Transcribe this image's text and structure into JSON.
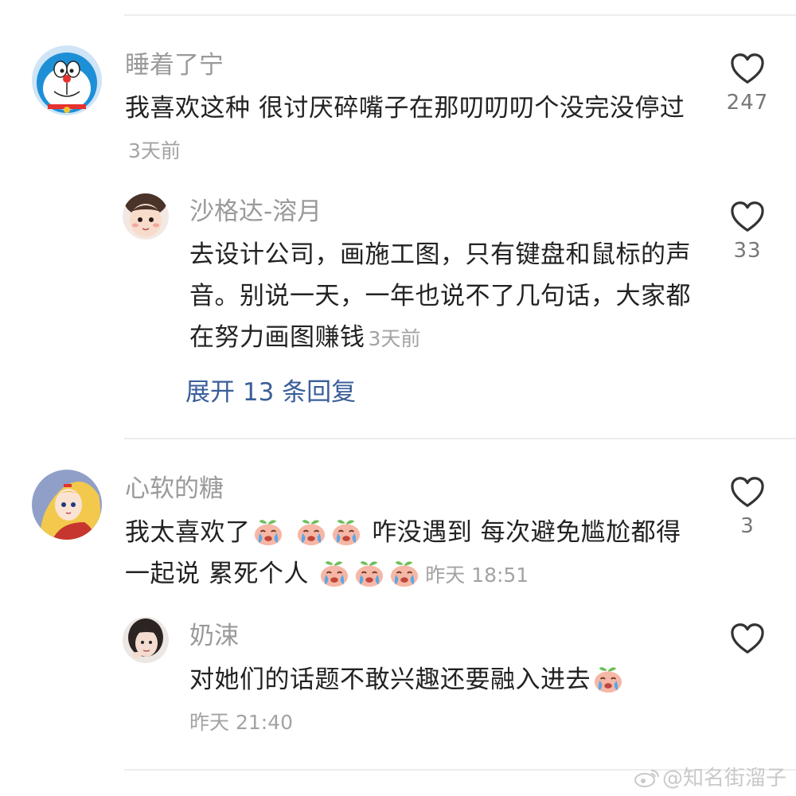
{
  "comments": [
    {
      "username": "睡着了宁",
      "text": "我喜欢这种 很讨厌碎嘴子在那叨叨叨个没完没停过",
      "time": "3天前",
      "likes": "247",
      "avatar_icon": "doraemon-avatar",
      "reply": {
        "username": "沙格达-溶月",
        "text": "去设计公司，画施工图，只有键盘和鼠标的声音。别说一天，一年也说不了几句话，大家都在努力画图赚钱",
        "time": "3天前",
        "likes": "33",
        "avatar_icon": "cute-girl-avatar"
      },
      "expand_label": "展开 13 条回复"
    },
    {
      "username": "心软的糖",
      "text_part1": "我太喜欢了",
      "text_part2": "咋没遇到 每次避免尴尬都得一起说 累死个人",
      "time": "昨天 18:51",
      "likes": "3",
      "avatar_icon": "anime-girl-avatar",
      "emoji_icon": "crying-peach-emoji",
      "reply": {
        "username": "奶涑",
        "text": "对她们的话题不敢兴趣还要融入进去",
        "time": "昨天 21:40",
        "avatar_icon": "girl-photo-avatar",
        "emoji_icon": "crying-peach-emoji"
      }
    }
  ],
  "watermark": "@知名街溜子",
  "colors": {
    "username": "#9a9a9a",
    "text": "#222222",
    "link": "#3b5e9a",
    "divider": "#ededed"
  }
}
